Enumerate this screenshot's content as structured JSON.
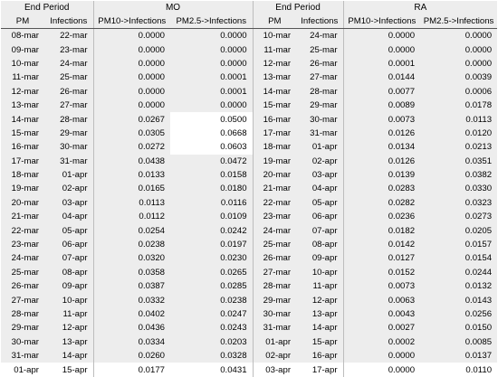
{
  "headers": {
    "left_period": "End Period",
    "mo": "MO",
    "right_period": "End Period",
    "ra": "RA",
    "col_pm": "PM",
    "col_infections": "Infections",
    "col_pm10": "PM10->Infections",
    "col_pm25": "PM2.5->Infections"
  },
  "highlighted_cells": "MO PM2.5->Infections values for 14-mar, 15-mar and 16-mar are shown on a white background",
  "rows": [
    [
      "08-mar",
      "22-mar",
      "0.0000",
      "0.0000",
      "10-mar",
      "24-mar",
      "0.0000",
      "0.0000"
    ],
    [
      "09-mar",
      "23-mar",
      "0.0000",
      "0.0000",
      "11-mar",
      "25-mar",
      "0.0000",
      "0.0000"
    ],
    [
      "10-mar",
      "24-mar",
      "0.0000",
      "0.0000",
      "12-mar",
      "26-mar",
      "0.0001",
      "0.0000"
    ],
    [
      "11-mar",
      "25-mar",
      "0.0000",
      "0.0001",
      "13-mar",
      "27-mar",
      "0.0144",
      "0.0039"
    ],
    [
      "12-mar",
      "26-mar",
      "0.0000",
      "0.0001",
      "14-mar",
      "28-mar",
      "0.0077",
      "0.0006"
    ],
    [
      "13-mar",
      "27-mar",
      "0.0000",
      "0.0000",
      "15-mar",
      "29-mar",
      "0.0089",
      "0.0178"
    ],
    [
      "14-mar",
      "28-mar",
      "0.0267",
      "0.0500",
      "16-mar",
      "30-mar",
      "0.0073",
      "0.0113"
    ],
    [
      "15-mar",
      "29-mar",
      "0.0305",
      "0.0668",
      "17-mar",
      "31-mar",
      "0.0126",
      "0.0120"
    ],
    [
      "16-mar",
      "30-mar",
      "0.0272",
      "0.0603",
      "18-mar",
      "01-apr",
      "0.0134",
      "0.0213"
    ],
    [
      "17-mar",
      "31-mar",
      "0.0438",
      "0.0472",
      "19-mar",
      "02-apr",
      "0.0126",
      "0.0351"
    ],
    [
      "18-mar",
      "01-apr",
      "0.0133",
      "0.0158",
      "20-mar",
      "03-apr",
      "0.0139",
      "0.0382"
    ],
    [
      "19-mar",
      "02-apr",
      "0.0165",
      "0.0180",
      "21-mar",
      "04-apr",
      "0.0283",
      "0.0330"
    ],
    [
      "20-mar",
      "03-apr",
      "0.0113",
      "0.0116",
      "22-mar",
      "05-apr",
      "0.0282",
      "0.0323"
    ],
    [
      "21-mar",
      "04-apr",
      "0.0112",
      "0.0109",
      "23-mar",
      "06-apr",
      "0.0236",
      "0.0273"
    ],
    [
      "22-mar",
      "05-apr",
      "0.0254",
      "0.0242",
      "24-mar",
      "07-apr",
      "0.0182",
      "0.0205"
    ],
    [
      "23-mar",
      "06-apr",
      "0.0238",
      "0.0197",
      "25-mar",
      "08-apr",
      "0.0142",
      "0.0157"
    ],
    [
      "24-mar",
      "07-apr",
      "0.0320",
      "0.0230",
      "26-mar",
      "09-apr",
      "0.0127",
      "0.0154"
    ],
    [
      "25-mar",
      "08-apr",
      "0.0358",
      "0.0265",
      "27-mar",
      "10-apr",
      "0.0152",
      "0.0244"
    ],
    [
      "26-mar",
      "09-apr",
      "0.0387",
      "0.0285",
      "28-mar",
      "11-apr",
      "0.0073",
      "0.0132"
    ],
    [
      "27-mar",
      "10-apr",
      "0.0332",
      "0.0238",
      "29-mar",
      "12-apr",
      "0.0063",
      "0.0143"
    ],
    [
      "28-mar",
      "11-apr",
      "0.0402",
      "0.0247",
      "30-mar",
      "13-apr",
      "0.0043",
      "0.0256"
    ],
    [
      "29-mar",
      "12-apr",
      "0.0436",
      "0.0243",
      "31-mar",
      "14-apr",
      "0.0027",
      "0.0150"
    ],
    [
      "30-mar",
      "13-apr",
      "0.0334",
      "0.0203",
      "01-apr",
      "15-apr",
      "0.0002",
      "0.0085"
    ],
    [
      "31-mar",
      "14-apr",
      "0.0260",
      "0.0328",
      "02-apr",
      "16-apr",
      "0.0000",
      "0.0137"
    ],
    [
      "01-apr",
      "15-apr",
      "0.0177",
      "0.0431",
      "03-apr",
      "17-apr",
      "0.0000",
      "0.0110"
    ]
  ]
}
